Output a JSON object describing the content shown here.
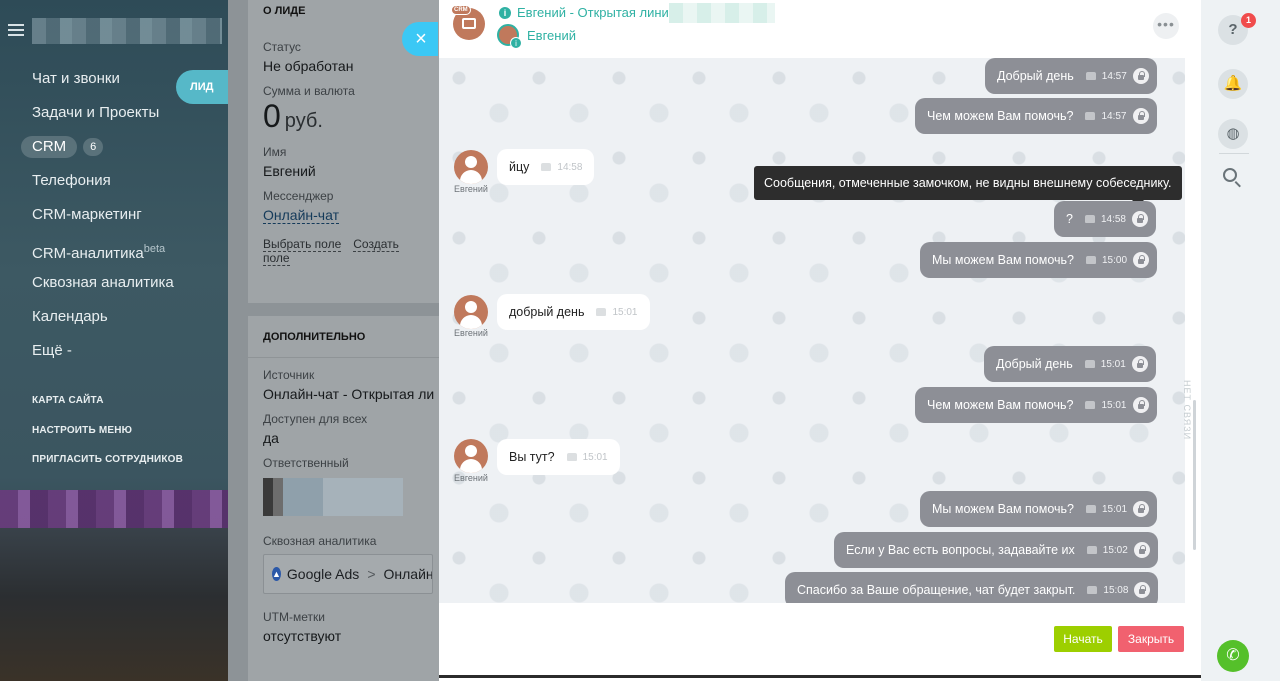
{
  "sidebar": {
    "menu": [
      {
        "label": "Чат и звонки"
      },
      {
        "label": "Задачи и Проекты"
      },
      {
        "label": "CRM",
        "badge": "6"
      },
      {
        "label": "Телефония"
      },
      {
        "label": "CRM-маркетинг"
      },
      {
        "label": "CRM-аналитика",
        "sup": "beta"
      },
      {
        "label": "Сквозная аналитика"
      },
      {
        "label": "Календарь"
      },
      {
        "label": "Ещё -"
      }
    ],
    "small_links": [
      "КАРТА САЙТА",
      "НАСТРОИТЬ МЕНЮ",
      "ПРИГЛАСИТЬ СОТРУДНИКОВ"
    ],
    "lid_tab": "ЛИД"
  },
  "lead": {
    "section_about": "О ЛИДЕ",
    "status_label": "Статус",
    "status_value": "Не обработан",
    "sum_label": "Сумма и валюта",
    "sum_value": "0",
    "sum_currency": "руб.",
    "name_label": "Имя",
    "name_value": "Евгений",
    "messenger_label": "Мессенджер",
    "messenger_value": "Онлайн-чат",
    "select_field": "Выбрать поле",
    "create_field": "Создать поле",
    "section_additional": "ДОПОЛНИТЕЛЬНО",
    "source_label": "Источник",
    "source_value": "Онлайн-чат - Открытая ли",
    "available_label": "Доступен для всех",
    "available_value": "да",
    "responsible_label": "Ответственный",
    "analytics_label": "Сквозная аналитика",
    "analytics_value1": "Google Ads",
    "analytics_sep": ">",
    "analytics_value2": "Онлайн",
    "utm_label": "UTM-метки",
    "utm_value": "отсутствуют"
  },
  "chat": {
    "header_title": "Евгений - Открытая линия",
    "header_user": "Евгений",
    "crm_tag": "CRM",
    "dots": "•••",
    "tooltip": "Сообщения, отмеченные замочком, не видны внешнему собеседнику.",
    "messages": [
      {
        "dir": "out",
        "text": "Добрый день",
        "time": "14:57"
      },
      {
        "dir": "out",
        "text": "Чем можем Вам помочь?",
        "time": "14:57"
      },
      {
        "dir": "in",
        "text": "йцу",
        "time": "14:58",
        "author": "Евгений"
      },
      {
        "dir": "out",
        "text": "?",
        "time": "14:58"
      },
      {
        "dir": "out",
        "text": "Мы можем Вам помочь?",
        "time": "15:00"
      },
      {
        "dir": "in",
        "text": "добрый день",
        "time": "15:01",
        "author": "Евгений"
      },
      {
        "dir": "out",
        "text": "Добрый день",
        "time": "15:01"
      },
      {
        "dir": "out",
        "text": "Чем можем Вам помочь?",
        "time": "15:01"
      },
      {
        "dir": "in",
        "text": "Вы тут?",
        "time": "15:01",
        "author": "Евгений"
      },
      {
        "dir": "out",
        "text": "Мы можем Вам помочь?",
        "time": "15:01"
      },
      {
        "dir": "out",
        "text": "Если у Вас есть вопросы, задавайте их",
        "time": "15:02"
      },
      {
        "dir": "out",
        "text": "Спасибо за Ваше обращение, чат будет закрыт.",
        "time": "15:08"
      }
    ],
    "btn_start": "Начать",
    "btn_close": "Закрыть"
  },
  "close_button": "×",
  "right_bar": {
    "help_badge": "1",
    "help_icon": "?",
    "vertical_text": "НЕТ СВЯЗИ"
  },
  "colors": {
    "accent_teal": "#2fb1a3",
    "close_blue": "#3bc8f5",
    "start_green": "#9dcf00",
    "close_red": "#f1616f",
    "out_bubble": "#8d8f96"
  }
}
